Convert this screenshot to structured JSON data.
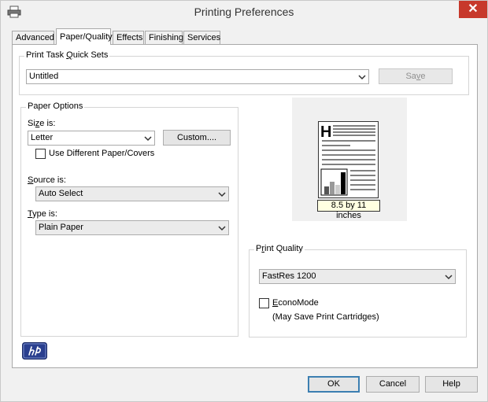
{
  "window": {
    "title": "Printing Preferences",
    "close_glyph": "✕"
  },
  "tabs": [
    {
      "label": "Advanced"
    },
    {
      "label": "Paper/Quality"
    },
    {
      "label": "Effects"
    },
    {
      "label": "Finishing"
    },
    {
      "label": "Services"
    }
  ],
  "quick_sets": {
    "group_label_pre": "Print Task ",
    "group_label_key": "Q",
    "group_label_post": "uick Sets",
    "value": "Untitled",
    "save_pre": "Sa",
    "save_key": "v",
    "save_post": "e"
  },
  "paper_options": {
    "group_label": "Paper Options",
    "size_label_pre": "Si",
    "size_label_key": "z",
    "size_label_post": "e is:",
    "size_value": "Letter",
    "custom_label": "Custom....",
    "different_paper_label": "Use Different Paper/Covers",
    "source_label_key": "S",
    "source_label_post": "ource is:",
    "source_value": "Auto Select",
    "type_label_key": "T",
    "type_label_post": "ype is:",
    "type_value": "Plain Paper"
  },
  "preview": {
    "size_text": "8.5 by 11 inches"
  },
  "print_quality": {
    "group_label_pre": "P",
    "group_label_key": "r",
    "group_label_post": "int Quality",
    "value": "FastRes 1200",
    "econo_key": "E",
    "econo_post": "conoMode",
    "econo_note": "(May Save Print Cartridges)"
  },
  "footer": {
    "ok": "OK",
    "cancel": "Cancel",
    "help": "Help"
  },
  "colors": {
    "close_red": "#c7382b",
    "hp_blue": "#2a3f8f",
    "default_border": "#3c7fb1"
  }
}
